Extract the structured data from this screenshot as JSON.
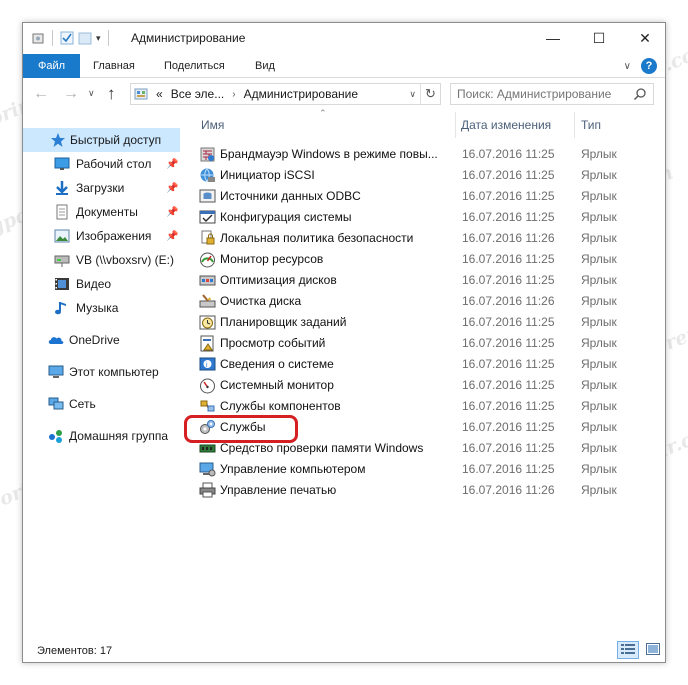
{
  "window": {
    "title": "Администрирование"
  },
  "window_controls": {
    "minimize": "—",
    "maximize": "☐",
    "close": "✕"
  },
  "ribbon": {
    "file_tab": "Файл",
    "tabs": [
      "Главная",
      "Поделиться",
      "Вид"
    ]
  },
  "navigation": {
    "address_segments": [
      "Все эле...",
      "Администрирование"
    ],
    "address_overflow": "«",
    "search_placeholder": "Поиск: Администрирование"
  },
  "nav_pane": {
    "items": [
      {
        "label": "Быстрый доступ",
        "icon": "star-icon",
        "selected": true,
        "pinned": false
      },
      {
        "label": "Рабочий стол",
        "icon": "desktop-icon",
        "selected": false,
        "pinned": true
      },
      {
        "label": "Загрузки",
        "icon": "downloads-icon",
        "selected": false,
        "pinned": true
      },
      {
        "label": "Документы",
        "icon": "documents-icon",
        "selected": false,
        "pinned": true
      },
      {
        "label": "Изображения",
        "icon": "pictures-icon",
        "selected": false,
        "pinned": true
      },
      {
        "label": "VB (\\\\vboxsrv) (E:)",
        "icon": "network-drive-icon",
        "selected": false,
        "pinned": false
      },
      {
        "label": "Видео",
        "icon": "videos-icon",
        "selected": false,
        "pinned": false
      },
      {
        "label": "Музыка",
        "icon": "music-icon",
        "selected": false,
        "pinned": false
      },
      {
        "label": "OneDrive",
        "icon": "onedrive-icon",
        "selected": false,
        "pinned": false
      },
      {
        "label": "Этот компьютер",
        "icon": "computer-icon",
        "selected": false,
        "pinned": false
      },
      {
        "label": "Сеть",
        "icon": "network-icon",
        "selected": false,
        "pinned": false
      },
      {
        "label": "Домашняя группа",
        "icon": "homegroup-icon",
        "selected": false,
        "pinned": false
      }
    ]
  },
  "file_list": {
    "columns": [
      "Имя",
      "Дата изменения",
      "Тип"
    ],
    "rows": [
      {
        "name": "Брандмауэр Windows в режиме повы...",
        "date": "16.07.2016 11:25",
        "type": "Ярлык",
        "icon": "firewall-icon"
      },
      {
        "name": "Инициатор iSCSI",
        "date": "16.07.2016 11:25",
        "type": "Ярлык",
        "icon": "iscsi-icon"
      },
      {
        "name": "Источники данных ODBC",
        "date": "16.07.2016 11:25",
        "type": "Ярлык",
        "icon": "odbc-icon"
      },
      {
        "name": "Конфигурация системы",
        "date": "16.07.2016 11:25",
        "type": "Ярлык",
        "icon": "msconfig-icon"
      },
      {
        "name": "Локальная политика безопасности",
        "date": "16.07.2016 11:26",
        "type": "Ярлык",
        "icon": "security-policy-icon"
      },
      {
        "name": "Монитор ресурсов",
        "date": "16.07.2016 11:25",
        "type": "Ярлык",
        "icon": "resource-monitor-icon"
      },
      {
        "name": "Оптимизация дисков",
        "date": "16.07.2016 11:25",
        "type": "Ярлык",
        "icon": "defrag-icon"
      },
      {
        "name": "Очистка диска",
        "date": "16.07.2016 11:26",
        "type": "Ярлык",
        "icon": "disk-cleanup-icon"
      },
      {
        "name": "Планировщик заданий",
        "date": "16.07.2016 11:25",
        "type": "Ярлык",
        "icon": "task-scheduler-icon"
      },
      {
        "name": "Просмотр событий",
        "date": "16.07.2016 11:25",
        "type": "Ярлык",
        "icon": "event-viewer-icon"
      },
      {
        "name": "Сведения о системе",
        "date": "16.07.2016 11:25",
        "type": "Ярлык",
        "icon": "system-info-icon"
      },
      {
        "name": "Системный монитор",
        "date": "16.07.2016 11:25",
        "type": "Ярлык",
        "icon": "performance-monitor-icon"
      },
      {
        "name": "Службы компонентов",
        "date": "16.07.2016 11:25",
        "type": "Ярлык",
        "icon": "component-services-icon"
      },
      {
        "name": "Службы",
        "date": "16.07.2016 11:25",
        "type": "Ярлык",
        "icon": "services-icon",
        "highlighted": true
      },
      {
        "name": "Средство проверки памяти Windows",
        "date": "16.07.2016 11:25",
        "type": "Ярлык",
        "icon": "memory-diagnostic-icon"
      },
      {
        "name": "Управление компьютером",
        "date": "16.07.2016 11:25",
        "type": "Ярлык",
        "icon": "computer-management-icon"
      },
      {
        "name": "Управление печатью",
        "date": "16.07.2016 11:26",
        "type": "Ярлык",
        "icon": "print-management-icon"
      }
    ]
  },
  "status_bar": {
    "count_text": "Элементов: 17"
  },
  "watermark": {
    "text": "Soringpcrepair.com"
  },
  "colors": {
    "accent": "#1979ca",
    "selection": "#cce8ff",
    "highlight_ring": "#d41f23"
  }
}
